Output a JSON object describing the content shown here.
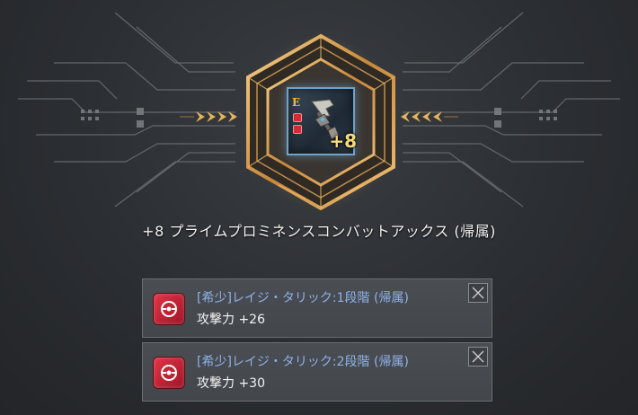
{
  "item": {
    "name": "+8 プライムプロミネンスコンバットアックス (帰属)",
    "grade_letter": "E",
    "enhance_label": "+8",
    "icon": "battle-axe-icon"
  },
  "decoration": {
    "emblem": "hexagon-emblem",
    "accent": "#d9a35a",
    "circuit_color": "#7a7d80"
  },
  "effects": [
    {
      "title": "[希少]レイジ・タリック:1段階 (帰属)",
      "stat": "攻撃力 +26",
      "icon": "rage-talic-icon",
      "close_icon": "close-icon"
    },
    {
      "title": "[希少]レイジ・タリック:2段階 (帰属)",
      "stat": "攻撃力 +30",
      "icon": "rage-talic-icon",
      "close_icon": "close-icon"
    }
  ],
  "colors": {
    "effect_title": "#8fb0e8",
    "talic_red": "#d22a3a",
    "enhance_gold": "#f4dc7a"
  }
}
